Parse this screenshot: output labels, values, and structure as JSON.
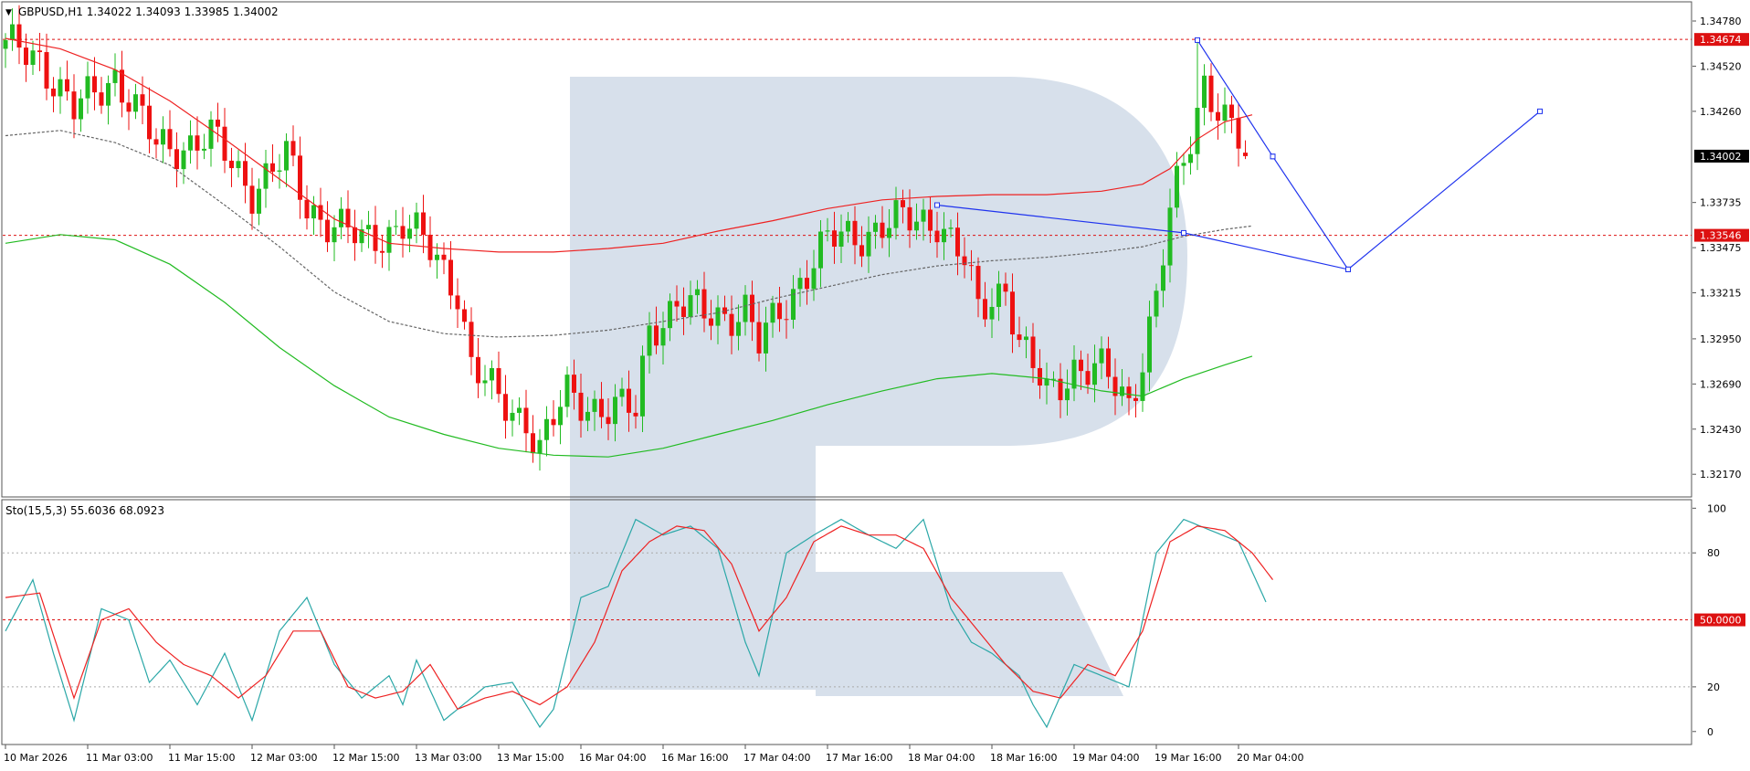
{
  "header": {
    "symbol_line": "GBPUSD,H1  1.34022 1.34093 1.33985 1.34002"
  },
  "watermark": {
    "name": "broker-logo-watermark",
    "color": "#d0dbe8"
  },
  "colors": {
    "bull": "#22bb22",
    "bear": "#ee1111",
    "ma_fast": "#ee2222",
    "ma_slow": "#22bb22",
    "ma_mid": "#666666",
    "forecast": "#1f33ee",
    "stoch_k": "#2aa7a7",
    "stoch_d": "#ee2222",
    "level": "#dd1111"
  },
  "chart_data": [
    {
      "type": "candlestick",
      "title": "GBPUSD,H1",
      "ohlc_last": {
        "open": "1.34022",
        "high": "1.34093",
        "low": "1.33985",
        "close": "1.34002"
      },
      "ylim": [
        1.3205,
        1.3488
      ],
      "y_ticks": [
        "1.34780",
        "1.34520",
        "1.34260",
        "1.33735",
        "1.33475",
        "1.33215",
        "1.32950",
        "1.32690",
        "1.32430",
        "1.32170"
      ],
      "y_tick_values": [
        1.3478,
        1.3452,
        1.3426,
        1.33735,
        1.33475,
        1.33215,
        1.3295,
        1.3269,
        1.3243,
        1.3217
      ],
      "x_ticks": [
        "10 Mar 2026",
        "11 Mar 03:00",
        "11 Mar 15:00",
        "12 Mar 03:00",
        "12 Mar 15:00",
        "13 Mar 03:00",
        "13 Mar 15:00",
        "16 Mar 04:00",
        "16 Mar 16:00",
        "17 Mar 04:00",
        "17 Mar 16:00",
        "18 Mar 04:00",
        "18 Mar 16:00",
        "19 Mar 04:00",
        "19 Mar 16:00",
        "20 Mar 04:00"
      ],
      "x_tick_bars": [
        0,
        12,
        24,
        36,
        48,
        60,
        72,
        84,
        96,
        108,
        120,
        132,
        144,
        156,
        168,
        180
      ],
      "current_price": "1.34002",
      "current_price_value": 1.34002,
      "levels": [
        {
          "label": "1.34674",
          "value": 1.34674
        },
        {
          "label": "1.33546",
          "value": 1.33546
        }
      ],
      "close_path_anchors": [
        [
          0,
          1.3462
        ],
        [
          5,
          1.3458
        ],
        [
          10,
          1.3425
        ],
        [
          16,
          1.3448
        ],
        [
          22,
          1.3405
        ],
        [
          30,
          1.341
        ],
        [
          36,
          1.3382
        ],
        [
          41,
          1.3398
        ],
        [
          44,
          1.3372
        ],
        [
          52,
          1.335
        ],
        [
          58,
          1.3362
        ],
        [
          62,
          1.3345
        ],
        [
          66,
          1.3325
        ],
        [
          68,
          1.328
        ],
        [
          72,
          1.3258
        ],
        [
          76,
          1.325
        ],
        [
          78,
          1.3232
        ],
        [
          82,
          1.3262
        ],
        [
          88,
          1.3255
        ],
        [
          92,
          1.3252
        ],
        [
          94,
          1.3302
        ],
        [
          98,
          1.3315
        ],
        [
          102,
          1.3308
        ],
        [
          108,
          1.3312
        ],
        [
          110,
          1.329
        ],
        [
          116,
          1.333
        ],
        [
          120,
          1.335
        ],
        [
          128,
          1.336
        ],
        [
          136,
          1.3365
        ],
        [
          140,
          1.3338
        ],
        [
          142,
          1.331
        ],
        [
          146,
          1.3328
        ],
        [
          148,
          1.3292
        ],
        [
          152,
          1.3262
        ],
        [
          156,
          1.328
        ],
        [
          160,
          1.3275
        ],
        [
          164,
          1.3258
        ],
        [
          166,
          1.3286
        ],
        [
          168,
          1.332
        ],
        [
          170,
          1.3365
        ],
        [
          173,
          1.341
        ],
        [
          175,
          1.3445
        ],
        [
          178,
          1.3422
        ],
        [
          181,
          1.34
        ]
      ],
      "spike_bars": [
        {
          "bar": 174,
          "high": 1.34674
        }
      ],
      "moving_averages": [
        {
          "style": "solid-red",
          "points": [
            [
              0,
              1.3468
            ],
            [
              8,
              1.3462
            ],
            [
              16,
              1.345
            ],
            [
              24,
              1.3432
            ],
            [
              32,
              1.341
            ],
            [
              40,
              1.3387
            ],
            [
              48,
              1.3364
            ],
            [
              56,
              1.335
            ],
            [
              64,
              1.3347
            ],
            [
              72,
              1.3345
            ],
            [
              80,
              1.3345
            ],
            [
              88,
              1.3347
            ],
            [
              96,
              1.335
            ],
            [
              104,
              1.3357
            ],
            [
              112,
              1.3363
            ],
            [
              120,
              1.337
            ],
            [
              128,
              1.3375
            ],
            [
              136,
              1.3377
            ],
            [
              144,
              1.3378
            ],
            [
              152,
              1.3378
            ],
            [
              160,
              1.338
            ],
            [
              166,
              1.3384
            ],
            [
              170,
              1.3393
            ],
            [
              174,
              1.341
            ],
            [
              178,
              1.342
            ],
            [
              182,
              1.3424
            ]
          ]
        },
        {
          "style": "dashed-gray",
          "points": [
            [
              0,
              1.3412
            ],
            [
              8,
              1.3415
            ],
            [
              16,
              1.3408
            ],
            [
              24,
              1.3395
            ],
            [
              32,
              1.3372
            ],
            [
              40,
              1.3348
            ],
            [
              48,
              1.3322
            ],
            [
              56,
              1.3305
            ],
            [
              64,
              1.3298
            ],
            [
              72,
              1.3296
            ],
            [
              80,
              1.3297
            ],
            [
              88,
              1.33
            ],
            [
              96,
              1.3305
            ],
            [
              104,
              1.331
            ],
            [
              112,
              1.3318
            ],
            [
              120,
              1.3325
            ],
            [
              128,
              1.3332
            ],
            [
              136,
              1.3337
            ],
            [
              144,
              1.334
            ],
            [
              152,
              1.3342
            ],
            [
              160,
              1.3345
            ],
            [
              166,
              1.3348
            ],
            [
              172,
              1.3354
            ],
            [
              178,
              1.3358
            ],
            [
              182,
              1.336
            ]
          ]
        },
        {
          "style": "solid-green",
          "points": [
            [
              0,
              1.335
            ],
            [
              8,
              1.3355
            ],
            [
              16,
              1.3352
            ],
            [
              24,
              1.3338
            ],
            [
              32,
              1.3316
            ],
            [
              40,
              1.329
            ],
            [
              48,
              1.3268
            ],
            [
              56,
              1.325
            ],
            [
              64,
              1.324
            ],
            [
              72,
              1.3232
            ],
            [
              80,
              1.3228
            ],
            [
              88,
              1.3227
            ],
            [
              96,
              1.3232
            ],
            [
              104,
              1.324
            ],
            [
              112,
              1.3248
            ],
            [
              120,
              1.3257
            ],
            [
              128,
              1.3265
            ],
            [
              136,
              1.3272
            ],
            [
              144,
              1.3275
            ],
            [
              152,
              1.3272
            ],
            [
              160,
              1.3265
            ],
            [
              166,
              1.3262
            ],
            [
              172,
              1.3272
            ],
            [
              178,
              1.328
            ],
            [
              182,
              1.3285
            ]
          ]
        }
      ],
      "forecast_lines": [
        {
          "points": [
            [
              136,
              1.3372
            ],
            [
              172,
              1.3356
            ],
            [
              196,
              1.3335
            ],
            [
              224,
              1.3426
            ]
          ]
        },
        {
          "points": [
            [
              174,
              1.3467
            ],
            [
              185,
              1.34
            ]
          ]
        },
        {
          "points": [
            [
              185,
              1.34
            ],
            [
              196,
              1.3335
            ]
          ]
        }
      ]
    },
    {
      "type": "line",
      "title": "Sto(15,5,3) 55.6036 68.0923",
      "ylim": [
        -5,
        103
      ],
      "y_ticks": [
        "100",
        "80",
        "20",
        "0"
      ],
      "y_tick_values": [
        100,
        80,
        20,
        0
      ],
      "levels": [
        {
          "label": "50.0000",
          "value": 50
        }
      ],
      "series": [
        {
          "name": "main",
          "anchors": [
            [
              0,
              45
            ],
            [
              4,
              68
            ],
            [
              7,
              35
            ],
            [
              10,
              5
            ],
            [
              14,
              55
            ],
            [
              18,
              50
            ],
            [
              21,
              22
            ],
            [
              24,
              32
            ],
            [
              28,
              12
            ],
            [
              32,
              35
            ],
            [
              36,
              5
            ],
            [
              40,
              45
            ],
            [
              44,
              60
            ],
            [
              48,
              30
            ],
            [
              52,
              15
            ],
            [
              56,
              25
            ],
            [
              58,
              12
            ],
            [
              60,
              32
            ],
            [
              64,
              5
            ],
            [
              70,
              20
            ],
            [
              74,
              22
            ],
            [
              78,
              2
            ],
            [
              80,
              10
            ],
            [
              84,
              60
            ],
            [
              88,
              65
            ],
            [
              92,
              95
            ],
            [
              96,
              88
            ],
            [
              100,
              92
            ],
            [
              104,
              82
            ],
            [
              108,
              40
            ],
            [
              110,
              25
            ],
            [
              114,
              80
            ],
            [
              118,
              88
            ],
            [
              122,
              95
            ],
            [
              126,
              88
            ],
            [
              130,
              82
            ],
            [
              134,
              95
            ],
            [
              138,
              55
            ],
            [
              141,
              40
            ],
            [
              144,
              35
            ],
            [
              148,
              25
            ],
            [
              150,
              12
            ],
            [
              152,
              2
            ],
            [
              156,
              30
            ],
            [
              160,
              25
            ],
            [
              164,
              20
            ],
            [
              168,
              80
            ],
            [
              172,
              95
            ],
            [
              176,
              90
            ],
            [
              180,
              85
            ],
            [
              184,
              58
            ]
          ]
        },
        {
          "name": "signal",
          "anchors": [
            [
              0,
              60
            ],
            [
              5,
              62
            ],
            [
              10,
              15
            ],
            [
              14,
              50
            ],
            [
              18,
              55
            ],
            [
              22,
              40
            ],
            [
              26,
              30
            ],
            [
              30,
              25
            ],
            [
              34,
              15
            ],
            [
              38,
              25
            ],
            [
              42,
              45
            ],
            [
              46,
              45
            ],
            [
              50,
              20
            ],
            [
              54,
              15
            ],
            [
              58,
              18
            ],
            [
              62,
              30
            ],
            [
              66,
              10
            ],
            [
              70,
              15
            ],
            [
              74,
              18
            ],
            [
              78,
              12
            ],
            [
              82,
              20
            ],
            [
              86,
              40
            ],
            [
              90,
              72
            ],
            [
              94,
              85
            ],
            [
              98,
              92
            ],
            [
              102,
              90
            ],
            [
              106,
              75
            ],
            [
              110,
              45
            ],
            [
              114,
              60
            ],
            [
              118,
              85
            ],
            [
              122,
              92
            ],
            [
              126,
              88
            ],
            [
              130,
              88
            ],
            [
              134,
              82
            ],
            [
              138,
              60
            ],
            [
              142,
              45
            ],
            [
              146,
              30
            ],
            [
              150,
              18
            ],
            [
              154,
              15
            ],
            [
              158,
              30
            ],
            [
              162,
              25
            ],
            [
              166,
              45
            ],
            [
              170,
              85
            ],
            [
              174,
              92
            ],
            [
              178,
              90
            ],
            [
              182,
              80
            ],
            [
              185,
              68
            ]
          ]
        }
      ]
    }
  ]
}
